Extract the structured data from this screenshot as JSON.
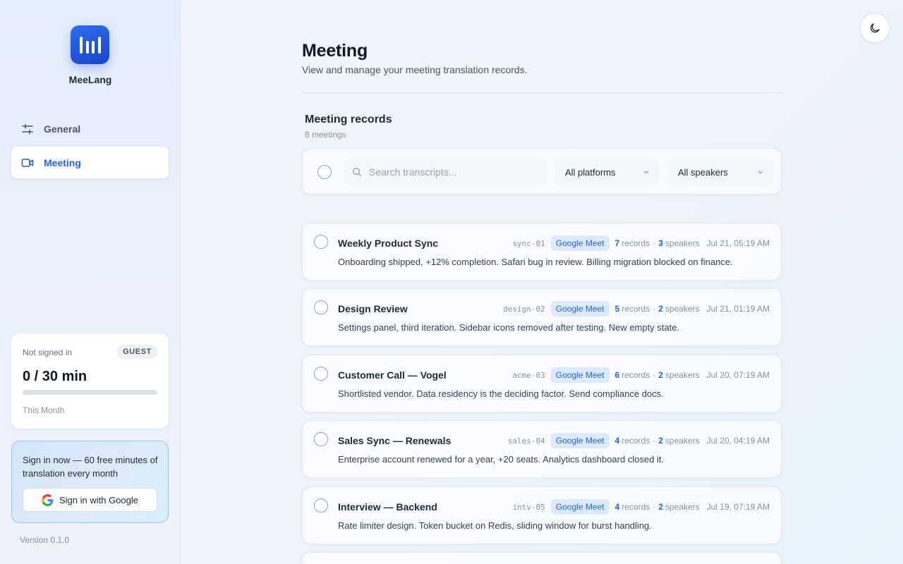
{
  "app": {
    "name": "MeeLang",
    "version": "Version 0.1.0"
  },
  "sidebar": {
    "items": [
      {
        "label": "General",
        "icon": "sliders-icon",
        "active": false
      },
      {
        "label": "Meeting",
        "icon": "video-camera-icon",
        "active": true
      }
    ]
  },
  "usage": {
    "status": "Not signed in",
    "badge": "GUEST",
    "value": "0 / 30 min",
    "used_fraction": 0,
    "period": "This Month"
  },
  "signin": {
    "text": "Sign in now — 60 free minutes of translation every month",
    "button": "Sign in with Google"
  },
  "header": {
    "title": "Meeting",
    "subtitle": "View and manage your meeting translation records."
  },
  "section": {
    "title": "Meeting records",
    "count": "8 meetings"
  },
  "filters": {
    "search_placeholder": "Search transcripts...",
    "platform": "All platforms",
    "speaker": "All speakers"
  },
  "records": [
    {
      "title": "Weekly Product Sync",
      "code": "sync-01",
      "platform": "Google Meet",
      "records": "7",
      "records_label": "records",
      "speakers": "3",
      "speakers_label": "speakers",
      "date": "Jul 21, 05:19 AM",
      "summary": "Onboarding shipped, +12% completion. Safari bug in review. Billing migration blocked on finance."
    },
    {
      "title": "Design Review",
      "code": "design-02",
      "platform": "Google Meet",
      "records": "5",
      "records_label": "records",
      "speakers": "2",
      "speakers_label": "speakers",
      "date": "Jul 21, 01:19 AM",
      "summary": "Settings panel, third iteration. Sidebar icons removed after testing. New empty state."
    },
    {
      "title": "Customer Call — Vogel",
      "code": "acme-03",
      "platform": "Google Meet",
      "records": "6",
      "records_label": "records",
      "speakers": "2",
      "speakers_label": "speakers",
      "date": "Jul 20, 07:19 AM",
      "summary": "Shortlisted vendor. Data residency is the deciding factor. Send compliance docs."
    },
    {
      "title": "Sales Sync — Renewals",
      "code": "sales-04",
      "platform": "Google Meet",
      "records": "4",
      "records_label": "records",
      "speakers": "2",
      "speakers_label": "speakers",
      "date": "Jul 20, 04:19 AM",
      "summary": "Enterprise account renewed for a year, +20 seats. Analytics dashboard closed it."
    },
    {
      "title": "Interview — Backend",
      "code": "intv-05",
      "platform": "Google Meet",
      "records": "4",
      "records_label": "records",
      "speakers": "2",
      "speakers_label": "speakers",
      "date": "Jul 19, 07:19 AM",
      "summary": "Rate limiter design. Token bucket on Redis, sliding window for burst handling."
    }
  ],
  "colors": {
    "accent": "#2563eb",
    "badge_bg": "#dbeafe",
    "logo": "#1f5be0"
  },
  "theme_toggle": {
    "icon": "moon-icon"
  }
}
